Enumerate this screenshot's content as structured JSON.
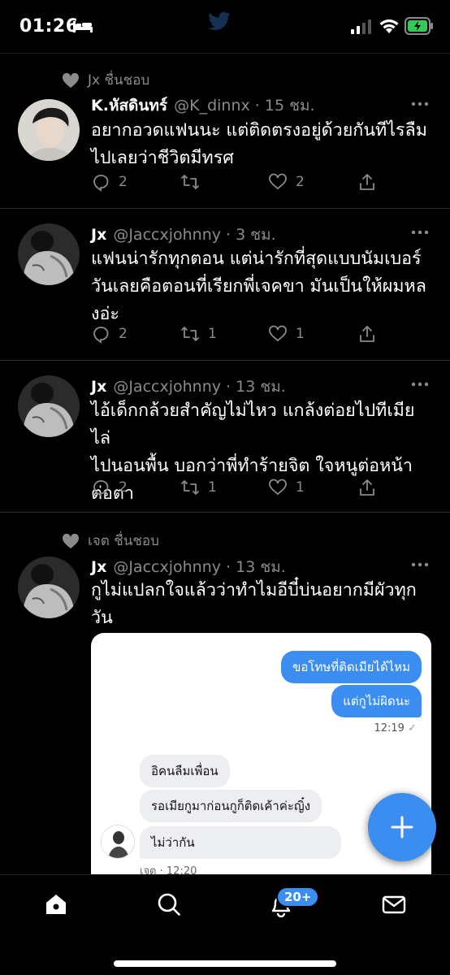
{
  "status_bar": {
    "time": "01:26"
  },
  "tweets": [
    {
      "social_context": "Jx ชื่นชอบ",
      "name": "K.หัสดินทร์",
      "handle": "@K_dinnx",
      "time": "15 ชม.",
      "lines": [
        "อยากอวดแฟนนะ แต่ติดตรงอยู่ด้วยกันทีไรลืม",
        "ไปเลยว่าชีวิตมีทรศ"
      ],
      "replies": "2",
      "retweets": "",
      "likes": "2"
    },
    {
      "name": "Jx",
      "handle": "@Jaccxjohnny",
      "time": "3 ชม.",
      "lines": [
        "แฟนน่ารักทุกตอน แต่น่ารักที่สุดแบบนัมเบอร์",
        "วันเลยคือตอนที่เรียกพี่เจคขา มันเป็นให้ผมหล",
        "งอ่ะ"
      ],
      "replies": "2",
      "retweets": "1",
      "likes": "1"
    },
    {
      "name": "Jx",
      "handle": "@Jaccxjohnny",
      "time": "13 ชม.",
      "lines": [
        "ไอ้เด็กกล้วยสำคัญไม่ไหว แกล้งต่อยไปทีเมียไล่",
        "ไปนอนพื้น บอกว่าพี่ทำร้ายจิต ใจหนูต่อหน้า",
        "ต่อตา"
      ],
      "replies": "2",
      "retweets": "1",
      "likes": "1"
    },
    {
      "social_context": "เจต ชื่นชอบ",
      "name": "Jx",
      "handle": "@Jaccxjohnny",
      "time": "13 ชม.",
      "lines": [
        "กูไม่แปลกใจแล้วว่าทำไมอีบี๋บ่นอยากมีผัวทุก",
        "วัน"
      ]
    }
  ],
  "chat": {
    "outgoing": [
      "ขอโทษที่ติดเมียได้ไหม",
      "แต่กูไม่ผิดนะ"
    ],
    "outgoing_time": "12:19",
    "incoming": [
      "อิคนลืมเพื่อน",
      "รอเมียกูมาก่อนกูก็ติดเค้าค่ะญิ๋ง",
      "ไม่ว่ากัน"
    ],
    "sender_line": "เจต · 12:20"
  },
  "nav": {
    "notification_badge": "20+"
  },
  "colors": {
    "accent": "#3b8ef0",
    "muted": "#8b8b8b",
    "background": "#000000"
  },
  "icons": [
    "bed-icon",
    "twitter-logo-icon",
    "heart-icon",
    "reply-icon",
    "retweet-icon",
    "share-icon",
    "more-icon",
    "plus-icon",
    "home-icon",
    "search-icon",
    "bell-icon",
    "mail-icon"
  ]
}
